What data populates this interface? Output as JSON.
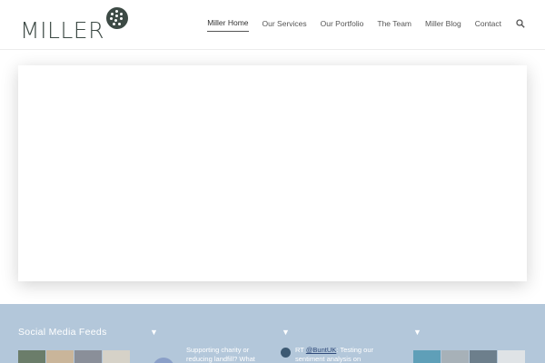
{
  "brand": {
    "name": "MILLER",
    "mark_color": "#3d4a45"
  },
  "nav": {
    "items": [
      "Miller Home",
      "Our Services",
      "Our Portfolio",
      "The Team",
      "Miller Blog",
      "Contact"
    ],
    "active": "Miller Home",
    "search_icon": "search-icon"
  },
  "footer": {
    "background": "#b3c7da",
    "social_title": "Social Media Feeds",
    "caret_icon": "triangle-down-icon",
    "facebook_post": "Supporting charity or reducing landfill? What",
    "twitter": {
      "icon": "twitter-icon",
      "prefix": "RT ",
      "handle": "@BuntUK",
      "text": ": Testing our sentiment analysis on"
    }
  }
}
